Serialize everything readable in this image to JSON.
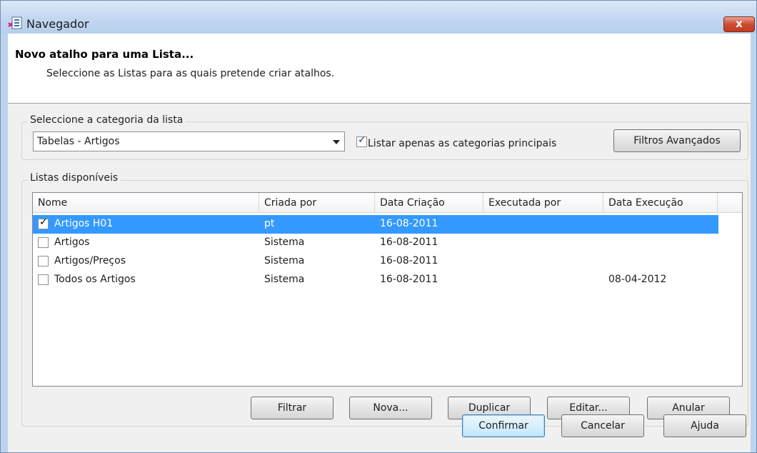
{
  "window": {
    "title": "Navegador",
    "close_label": "x"
  },
  "header": {
    "title": "Novo atalho para uma Lista...",
    "subtitle": "Seleccione as Listas para as quais pretende criar atalhos."
  },
  "category_group": {
    "label": "Seleccione a categoria da lista",
    "selected_category": "Tabelas - Artigos",
    "main_only_label": "Listar apenas as categorias principais",
    "main_only_checked": true,
    "advanced_filters_label": "Filtros Avançados"
  },
  "lists_group": {
    "label": "Listas disponíveis",
    "columns": [
      "Nome",
      "Criada por",
      "Data Criação",
      "Executada por",
      "Data Execução"
    ],
    "rows": [
      {
        "checked": true,
        "name": "Artigos H01",
        "created_by": "pt",
        "created_date": "16-08-2011",
        "executed_by": "",
        "executed_date": "",
        "selected": true
      },
      {
        "checked": false,
        "name": "Artigos",
        "created_by": "Sistema",
        "created_date": "16-08-2011",
        "executed_by": "",
        "executed_date": ""
      },
      {
        "checked": false,
        "name": "Artigos/Preços",
        "created_by": "Sistema",
        "created_date": "16-08-2011",
        "executed_by": "",
        "executed_date": ""
      },
      {
        "checked": false,
        "name": "Todos os Artigos",
        "created_by": "Sistema",
        "created_date": "16-08-2011",
        "executed_by": "",
        "executed_date": "08-04-2012"
      }
    ],
    "buttons": {
      "filter": "Filtrar",
      "new": "Nova...",
      "duplicate": "Duplicar",
      "edit": "Editar...",
      "cancel": "Anular"
    }
  },
  "footer": {
    "confirm": "Confirmar",
    "cancel": "Cancelar",
    "help": "Ajuda"
  },
  "colors": {
    "selection": "#3399ff",
    "default_button_border": "#3c7fb1",
    "close_button": "#c43b22"
  }
}
